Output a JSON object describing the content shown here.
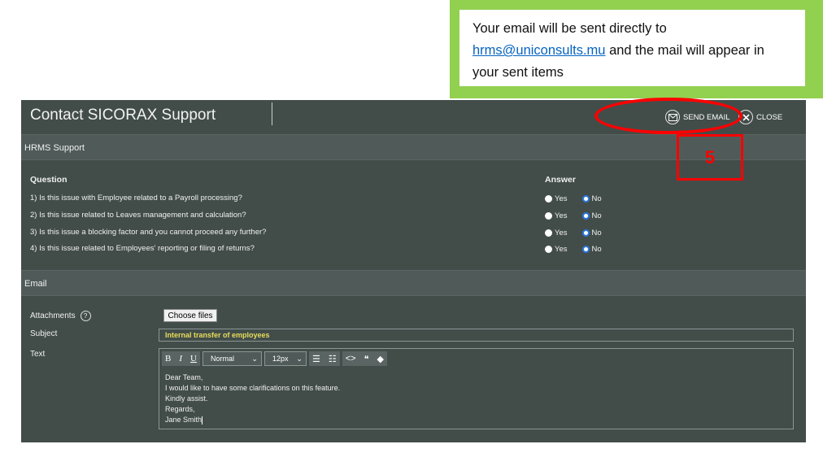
{
  "callout": {
    "line_prefix": "Your email will be sent directly to",
    "email_link": "hrms@uniconsults.mu",
    "line_suffix": " and the mail will appear in your sent items"
  },
  "window": {
    "title": "Contact SICORAX Support",
    "send_label": "SEND EMAIL",
    "close_label": "CLOSE"
  },
  "hrms_section": {
    "title": "HRMS Support",
    "question_header": "Question",
    "answer_header": "Answer",
    "yes_label": "Yes",
    "no_label": "No",
    "questions": [
      {
        "text": "1) Is this issue with Employee related to a Payroll processing?",
        "selected": "No"
      },
      {
        "text": "2) Is this issue related to Leaves management and calculation?",
        "selected": "No"
      },
      {
        "text": "3) Is this issue a blocking factor and you cannot proceed any further?",
        "selected": "No"
      },
      {
        "text": "4) Is this issue related to Employees' reporting or filing of returns?",
        "selected": "No"
      }
    ]
  },
  "email_section": {
    "title": "Email",
    "attachments_label": "Attachments",
    "help_symbol": "?",
    "choose_files_label": "Choose files",
    "subject_label": "Subject",
    "subject_value": "Internal transfer of employees",
    "text_label": "Text",
    "toolbar": {
      "bold": "B",
      "italic": "I",
      "underline": "U",
      "format_value": "Normal",
      "size_value": "12px"
    },
    "body_lines": [
      "Dear Team,",
      "I would like to have some clarifications on this feature.",
      "Kindly assist.",
      "Regards,",
      "Jane Smith"
    ]
  },
  "annotation": {
    "step_number": "5",
    "color": "#ff0000"
  },
  "colors": {
    "callout_border": "#92d050",
    "app_background": "#424d4a",
    "radio_selected": "#2b78e4",
    "subject_text": "#e8dc5a"
  }
}
